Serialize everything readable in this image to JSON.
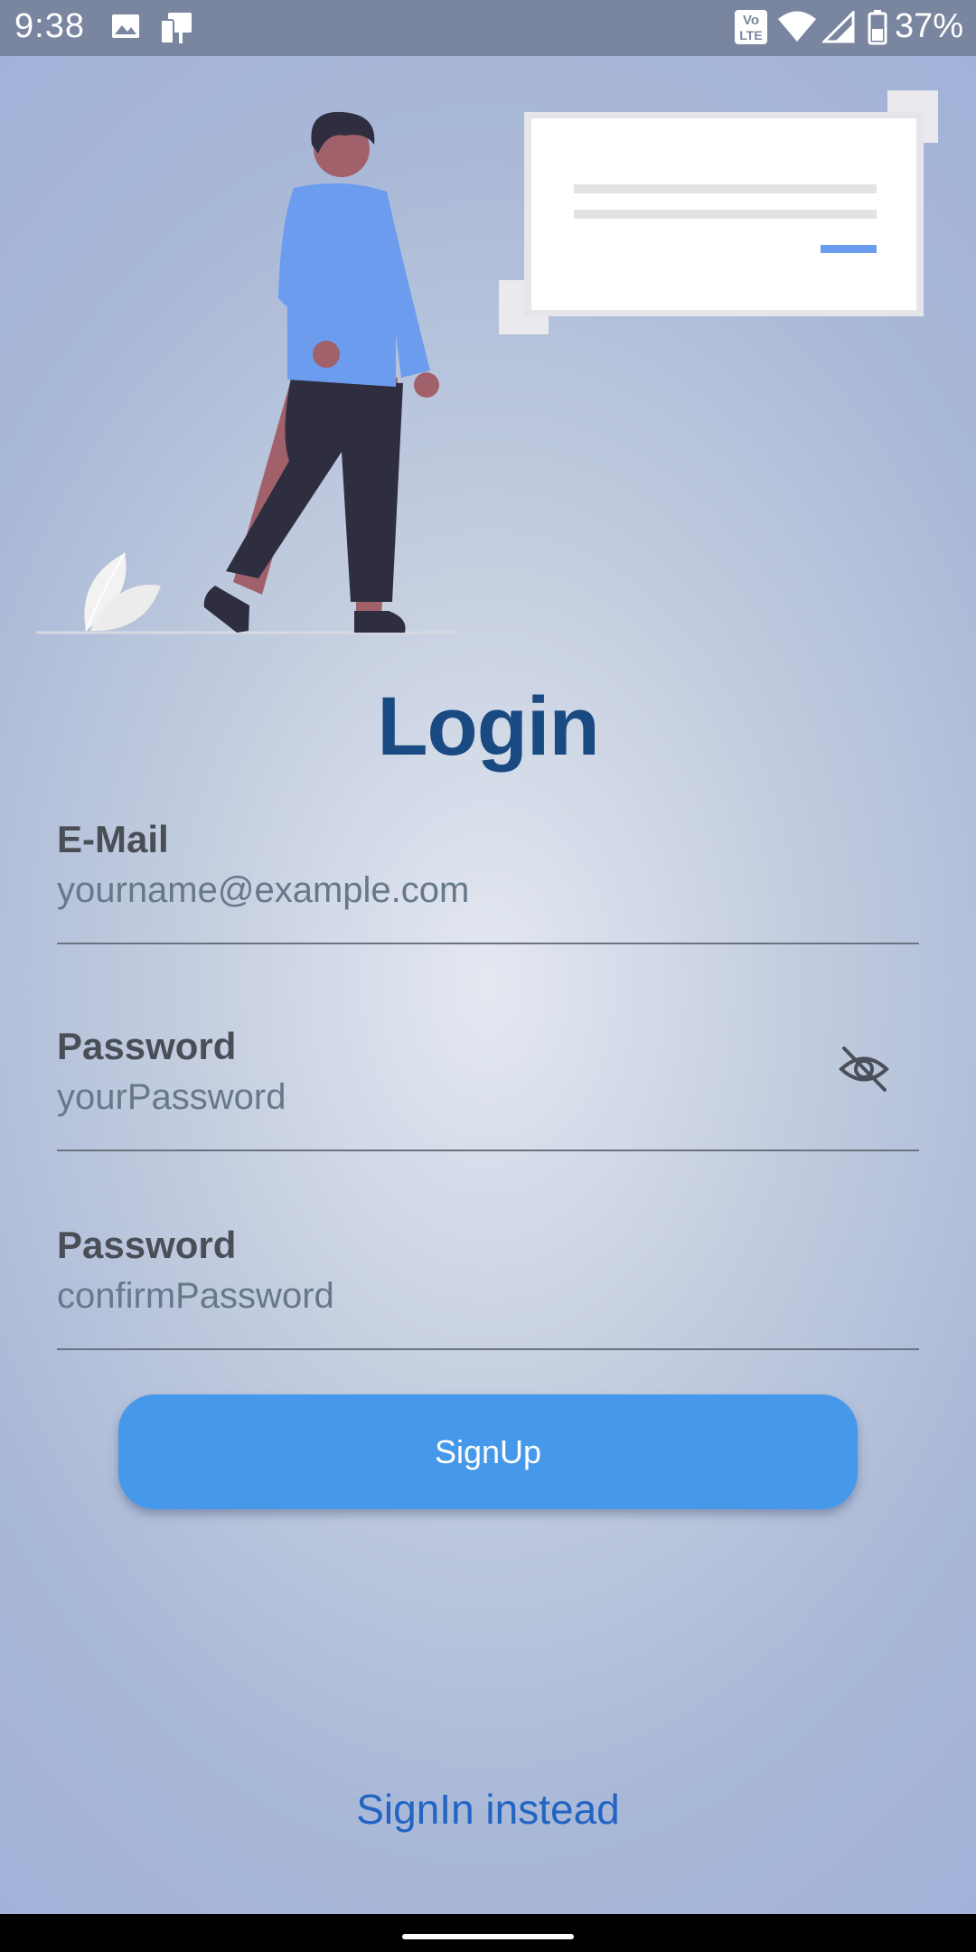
{
  "status_bar": {
    "time": "9:38",
    "battery_percent": "37%",
    "icons": [
      "image-icon",
      "device-transfer-icon",
      "volte-icon",
      "wifi-icon",
      "signal-icon",
      "battery-icon"
    ],
    "volte_top": "Vo",
    "volte_bottom": "LTE"
  },
  "illustration": {
    "name": "person-walking-with-message-card",
    "colors": {
      "shirt": "#6b9cee",
      "pants": "#2f2e41",
      "skin": "#a0616a",
      "hair": "#2f2e41",
      "card": "#ffffff",
      "accent": "#6b9cee"
    }
  },
  "title": "Login",
  "form": {
    "email": {
      "label": "E-Mail",
      "placeholder": "yourname@example.com"
    },
    "password": {
      "label": "Password",
      "placeholder": "yourPassword",
      "toggle_icon": "eye-off-icon"
    },
    "confirm_password": {
      "label": "Password",
      "placeholder": "confirmPassword"
    }
  },
  "signup_button": {
    "label": "SignUp",
    "color": "#4698ea"
  },
  "signin_link": {
    "label": "SignIn instead",
    "color": "#2264c4"
  },
  "colors": {
    "status_bar": "#7a86a0",
    "title": "#1a4a82"
  }
}
